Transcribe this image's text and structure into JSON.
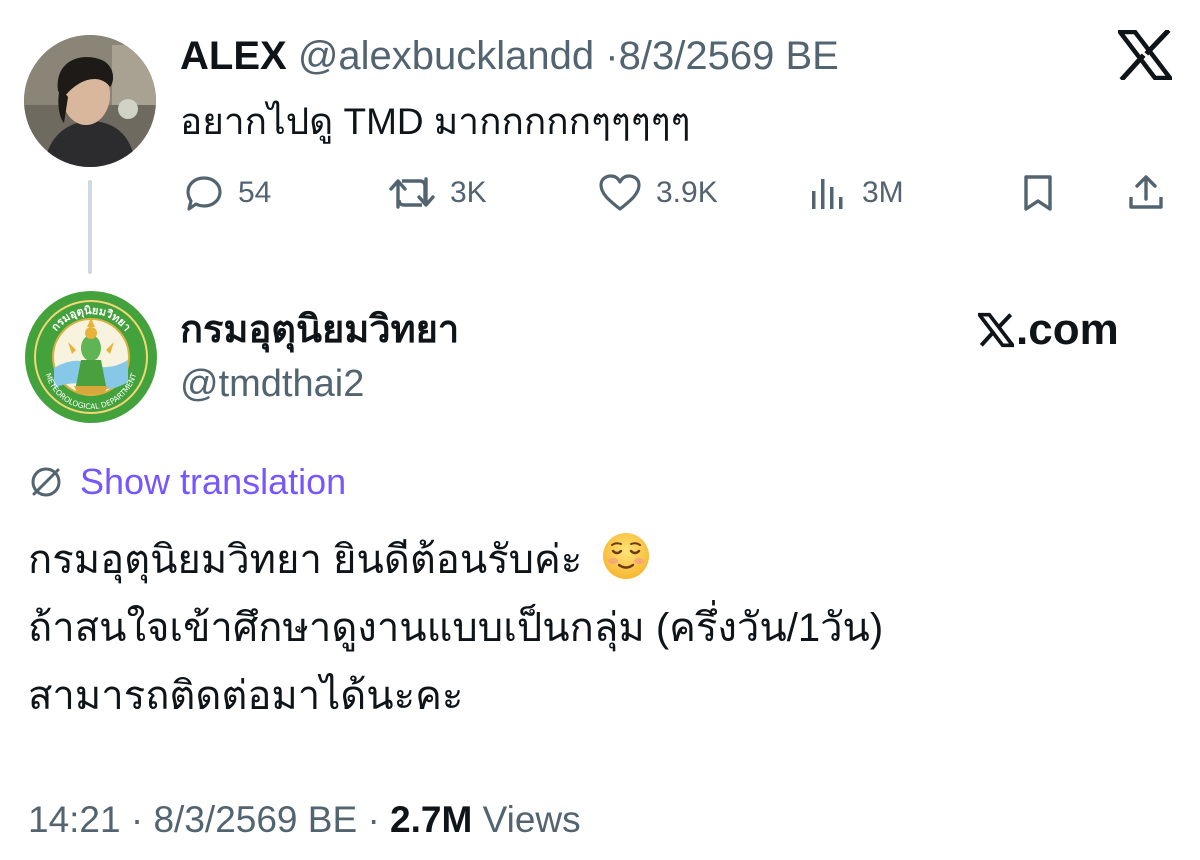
{
  "parent_tweet": {
    "display_name": "ALEX",
    "handle": "@alexbucklandd",
    "separator": "·",
    "date": "8/3/2569 BE",
    "text": "อยากไปดู TMD มากกกกกๆๆๆๆๆ",
    "actions": {
      "replies": "54",
      "reposts": "3K",
      "likes": "3.9K",
      "views": "3M"
    },
    "icons": [
      "x-logo-icon",
      "reply-icon",
      "repost-icon",
      "like-icon",
      "views-icon",
      "bookmark-icon",
      "share-icon"
    ]
  },
  "reply_tweet": {
    "display_name": "กรมอุตุนิยมวิทยา",
    "handle": "@tmdthai2",
    "avatar_text": "กรมอุตุนิยมวิทยา",
    "avatar_subtext": "METEOROLOGICAL DEPARTMENT",
    "brand": "𝕏.com",
    "brand_suffix": ".com",
    "translate_label": "Show translation",
    "lines": [
      "กรมอุตุนิยมวิทยา ยินดีต้อนรับค่ะ",
      "ถ้าสนใจเข้าศึกษาดูงานแบบเป็นกลุ่ม (ครึ่งวัน/1วัน)",
      "สามารถติดต่อมาได้นะคะ"
    ],
    "emoji": "smiling-face-emoji",
    "time": "14:21",
    "separator": "·",
    "date": "8/3/2569 BE",
    "views_count": "2.7M",
    "views_label": "Views"
  },
  "colors": {
    "text_primary": "#0f1419",
    "text_secondary": "#536471",
    "translate_link": "#7856ff",
    "thread_line": "#cfd9de",
    "seal_green": "#3f9a3a"
  }
}
